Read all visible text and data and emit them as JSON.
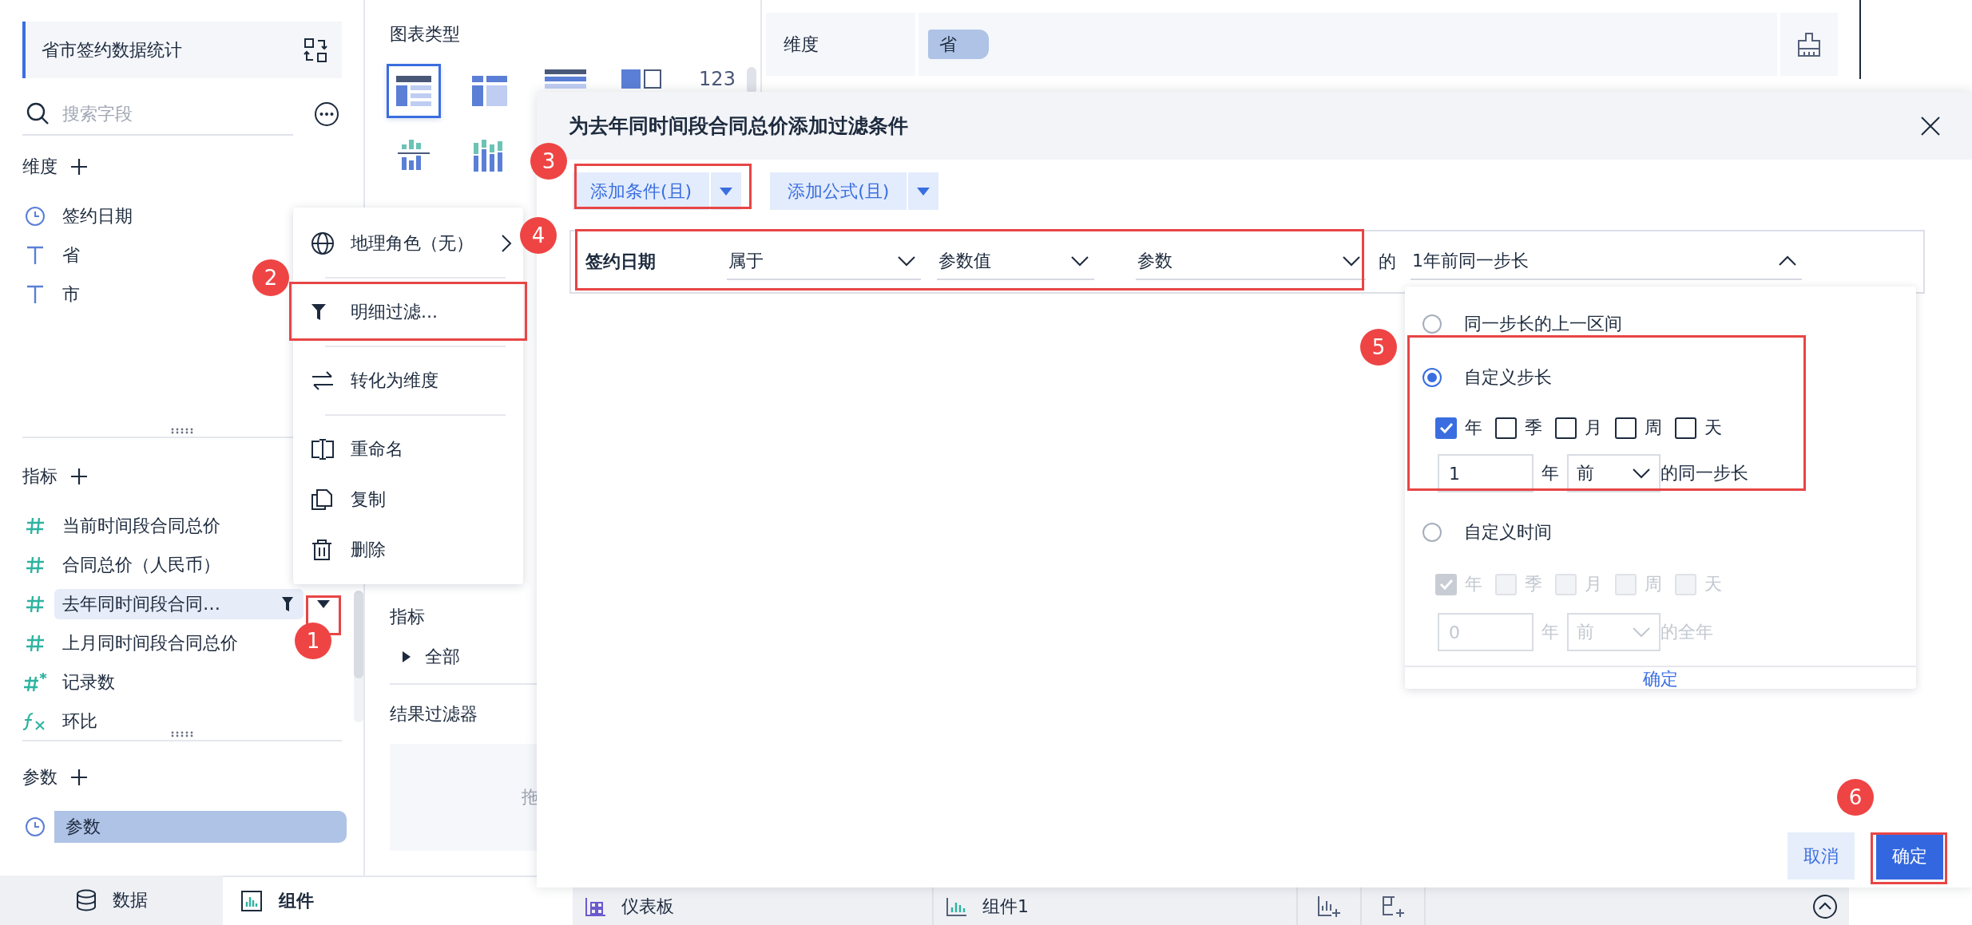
{
  "sidebar": {
    "title": "省市签约数据统计",
    "search": {
      "placeholder": "搜索字段"
    },
    "sections": [
      {
        "kind": "dimension",
        "title": "维度",
        "fields": [
          {
            "name": "签约日期",
            "kind": "date",
            "selected": false,
            "filtered": false
          },
          {
            "name": "省",
            "kind": "text",
            "selected": false,
            "filtered": false
          },
          {
            "name": "市",
            "kind": "text",
            "selected": false,
            "filtered": false
          }
        ]
      },
      {
        "kind": "metric",
        "title": "指标",
        "fields": [
          {
            "name": "当前时间段合同总价",
            "kind": "number",
            "selected": false,
            "filtered": false
          },
          {
            "name": "合同总价（人民币）",
            "kind": "number",
            "selected": false,
            "filtered": false
          },
          {
            "name": "去年同时间段合同…",
            "kind": "number",
            "selected": true,
            "filtered": true
          },
          {
            "name": "上月同时间段合同总价",
            "kind": "number",
            "selected": false,
            "filtered": false
          },
          {
            "name": "记录数",
            "kind": "count",
            "selected": false,
            "filtered": false
          },
          {
            "name": "环比",
            "kind": "formula",
            "selected": false,
            "filtered": false
          }
        ]
      },
      {
        "kind": "parameter",
        "title": "参数",
        "fields": [
          {
            "name": "参数",
            "kind": "date",
            "selected": false,
            "filtered": false
          }
        ]
      }
    ]
  },
  "bottom_tabs": [
    {
      "label": "数据",
      "kind": "data",
      "selected": false
    },
    {
      "label": "组件",
      "kind": "component",
      "selected": true
    }
  ],
  "config_panel": {
    "chart_type_title": "图表类型",
    "chart_types": [
      {
        "kind": "table",
        "selected": true
      },
      {
        "kind": "cross_table",
        "selected": false
      },
      {
        "kind": "detail_table",
        "selected": false
      },
      {
        "kind": "kpi",
        "selected": false
      },
      {
        "kind": "number",
        "label": "123",
        "selected": false
      },
      {
        "kind": "bar",
        "selected": false
      },
      {
        "kind": "grouped_bar",
        "selected": false
      }
    ],
    "metrics_title": "指标",
    "metrics_group": {
      "label": "全部",
      "expanded": false
    },
    "result_filter_title": "结果过滤器",
    "drop_hint": "拖"
  },
  "shelf": {
    "label": "维度",
    "pills": [
      "省"
    ]
  },
  "context_menu": {
    "groups": [
      [
        {
          "label": "地理角色（无）",
          "kind": "globe",
          "submenu": true
        }
      ],
      [
        {
          "label": "明细过滤...",
          "kind": "filter",
          "submenu": false
        }
      ],
      [
        {
          "label": "转化为维度",
          "kind": "convert",
          "submenu": false
        }
      ],
      [
        {
          "label": "重命名",
          "kind": "rename",
          "submenu": false
        },
        {
          "label": "复制",
          "kind": "copy",
          "submenu": false
        },
        {
          "label": "删除",
          "kind": "delete",
          "submenu": false
        }
      ]
    ]
  },
  "dialog": {
    "title": "为去年同时间段合同总价添加过滤条件",
    "add_buttons": [
      {
        "label": "添加条件(且)"
      },
      {
        "label": "添加公式(且)"
      }
    ],
    "condition": {
      "field": "签约日期",
      "operator": "属于",
      "value_type": "参数值",
      "parameter": "参数",
      "connector": "的",
      "range": "1年前同一步长",
      "range_open": true
    },
    "range_popup": {
      "options": [
        {
          "kind": "plain",
          "label": "同一步长的上一区间",
          "selected": false
        },
        {
          "kind": "custom",
          "label": "自定义步长",
          "selected": true,
          "units": [
            {
              "label": "年",
              "checked": true
            },
            {
              "label": "季",
              "checked": false
            },
            {
              "label": "月",
              "checked": false
            },
            {
              "label": "周",
              "checked": false
            },
            {
              "label": "天",
              "checked": false
            }
          ],
          "amount": "1",
          "amount_unit": "年",
          "direction": "前",
          "suffix": "的同一步长"
        },
        {
          "kind": "custom",
          "label": "自定义时间",
          "selected": false,
          "units": [
            {
              "label": "年",
              "checked": true
            },
            {
              "label": "季",
              "checked": false
            },
            {
              "label": "月",
              "checked": false
            },
            {
              "label": "周",
              "checked": false
            },
            {
              "label": "天",
              "checked": false
            }
          ],
          "amount": "0",
          "amount_unit": "年",
          "direction": "前",
          "suffix": "的全年"
        }
      ],
      "confirm": "确定"
    },
    "footer_buttons": [
      {
        "label": "取消",
        "kind": "secondary"
      },
      {
        "label": "确定",
        "kind": "primary"
      }
    ]
  },
  "bottom_bar": {
    "items": [
      {
        "label": "仪表板",
        "kind": "dashboard"
      },
      {
        "label": "组件1",
        "kind": "component"
      }
    ]
  },
  "annotations": [
    {
      "number": "1"
    },
    {
      "number": "2"
    },
    {
      "number": "3"
    },
    {
      "number": "4"
    },
    {
      "number": "5"
    },
    {
      "number": "6"
    }
  ]
}
